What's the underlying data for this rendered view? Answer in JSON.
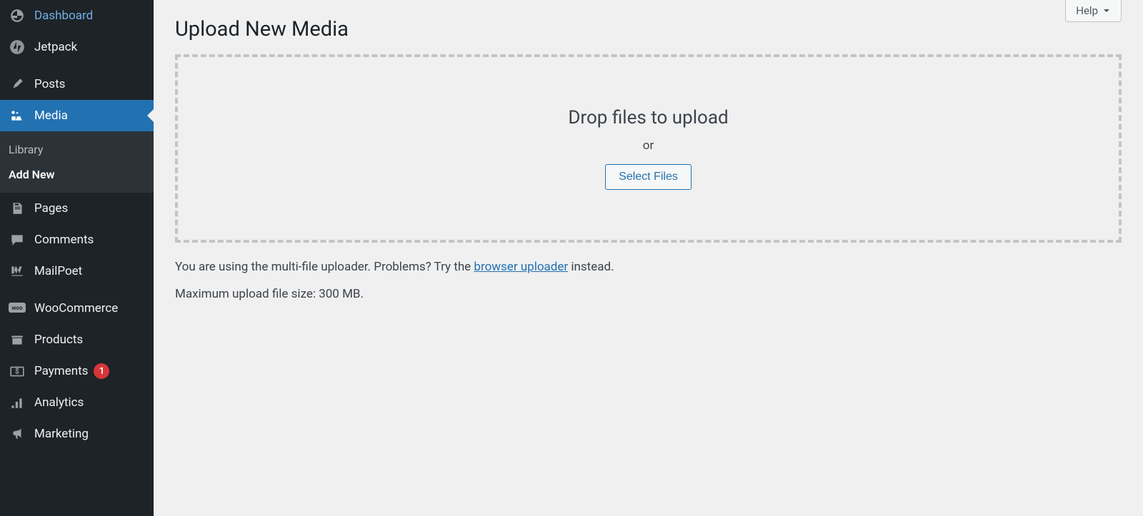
{
  "sidebar": {
    "dashboard": "Dashboard",
    "jetpack": "Jetpack",
    "posts": "Posts",
    "media": "Media",
    "media_library": "Library",
    "media_addnew": "Add New",
    "pages": "Pages",
    "comments": "Comments",
    "mailpoet": "MailPoet",
    "woocommerce": "WooCommerce",
    "products": "Products",
    "payments": "Payments",
    "payments_badge": "1",
    "analytics": "Analytics",
    "marketing": "Marketing"
  },
  "header": {
    "help": "Help"
  },
  "main": {
    "title": "Upload New Media",
    "drop_text": "Drop files to upload",
    "or_text": "or",
    "select_files": "Select Files",
    "uploader_info_prefix": "You are using the multi-file uploader. Problems? Try the ",
    "uploader_info_link": "browser uploader",
    "uploader_info_suffix": " instead.",
    "max_size": "Maximum upload file size: 300 MB."
  }
}
